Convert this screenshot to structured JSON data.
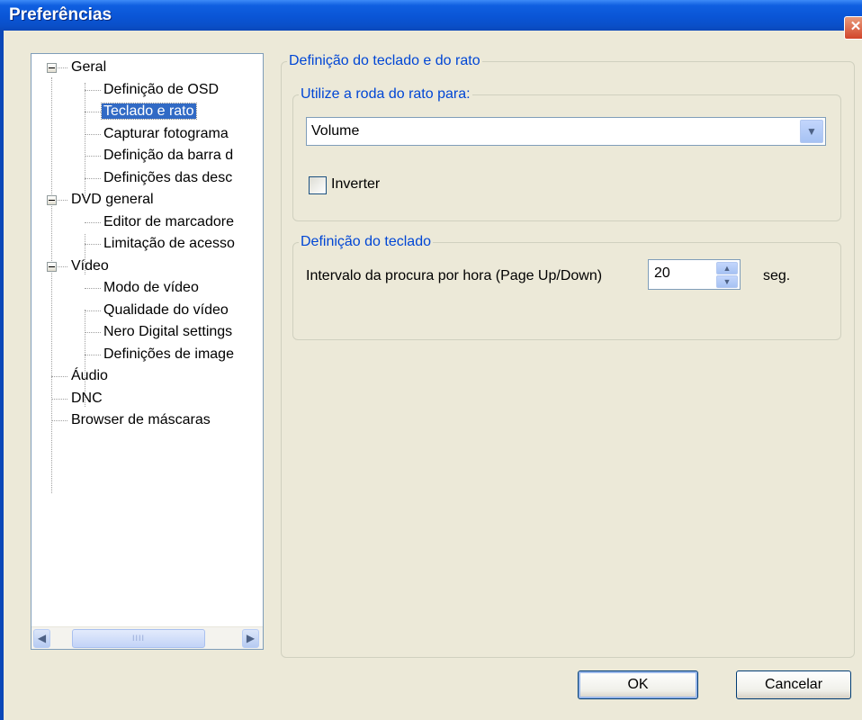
{
  "window": {
    "title": "Preferências",
    "close_label": "✕"
  },
  "tree": {
    "items": [
      {
        "label": "Geral",
        "expander": "−"
      },
      {
        "label": "Definição de OSD"
      },
      {
        "label": "Teclado e rato",
        "selected": true
      },
      {
        "label": "Capturar fotograma"
      },
      {
        "label": "Definição da barra d"
      },
      {
        "label": "Definições das desc"
      },
      {
        "label": "DVD general",
        "expander": "−"
      },
      {
        "label": "Editor de marcadore"
      },
      {
        "label": "Limitação de acesso"
      },
      {
        "label": "Vídeo",
        "expander": "−"
      },
      {
        "label": "Modo de vídeo"
      },
      {
        "label": "Qualidade do vídeo"
      },
      {
        "label": "Nero Digital settings"
      },
      {
        "label": "Definições de image"
      },
      {
        "label": "Áudio"
      },
      {
        "label": "DNC"
      },
      {
        "label": "Browser de máscaras"
      }
    ],
    "scrollbar": {
      "left_arrow": "◀",
      "right_arrow": "▶",
      "grip": "IIII"
    }
  },
  "settings": {
    "group_title": "Definição do teclado e do rato",
    "mouse_wheel": {
      "title": "Utilize a roda do rato para:",
      "selected_value": "Volume",
      "dropdown_arrow": "▼",
      "invert_label": "Inverter",
      "invert_checked": false
    },
    "keyboard": {
      "title": "Definição do teclado",
      "interval_label": "Intervalo da procura por hora (Page Up/Down)",
      "interval_value": "20",
      "spin_up": "▲",
      "spin_down": "▼",
      "unit": "seg."
    }
  },
  "buttons": {
    "ok": "OK",
    "cancel": "Cancelar"
  },
  "colors": {
    "titlebar": "#0a55d6",
    "selection": "#316ac5",
    "group_title": "#0046d5",
    "dialog_bg": "#ece9d8"
  }
}
